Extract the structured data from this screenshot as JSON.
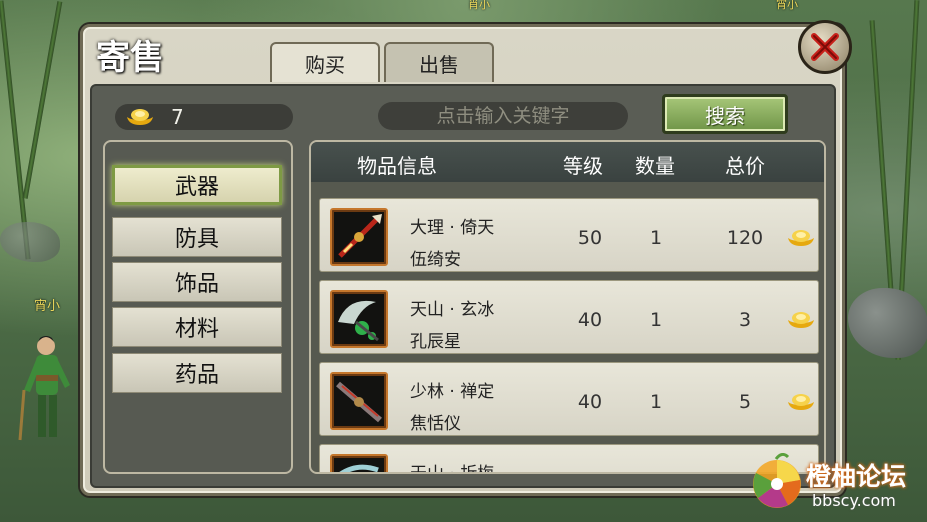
{
  "title": "寄售",
  "tabs": [
    {
      "label": "购买",
      "active": true
    },
    {
      "label": "出售",
      "active": false
    }
  ],
  "gold": {
    "amount": "7",
    "icon": "gold-ingot-icon"
  },
  "search": {
    "placeholder": "点击输入关键字",
    "button_label": "搜索"
  },
  "categories": [
    {
      "label": "武器",
      "active": true
    },
    {
      "label": "防具",
      "active": false
    },
    {
      "label": "饰品",
      "active": false
    },
    {
      "label": "材料",
      "active": false
    },
    {
      "label": "药品",
      "active": false
    }
  ],
  "table": {
    "columns": [
      "物品信息",
      "等级",
      "数量",
      "总价"
    ],
    "rows": [
      {
        "name": "大理 · 倚天",
        "seller": "伍绮安",
        "level": "50",
        "qty": "1",
        "price": "120",
        "icon": "spear-icon"
      },
      {
        "name": "天山 · 玄冰",
        "seller": "孔辰星",
        "level": "40",
        "qty": "1",
        "price": "3",
        "icon": "blade-icon"
      },
      {
        "name": "少林 · 禅定",
        "seller": "焦恬仪",
        "level": "40",
        "qty": "1",
        "price": "5",
        "icon": "staff-icon"
      },
      {
        "name": "天山 · 折梅",
        "seller": "",
        "level": "",
        "qty": "",
        "price": "",
        "icon": "sword-icon"
      }
    ]
  },
  "npc_names": [
    "宵小",
    "肖小",
    "宵小"
  ],
  "watermark": {
    "title": "橙柚论坛",
    "url": "bbscy.com"
  },
  "colors": {
    "accent_green": "#7e9a44",
    "gold": "#f2c21c",
    "close_red": "#c8201a"
  }
}
